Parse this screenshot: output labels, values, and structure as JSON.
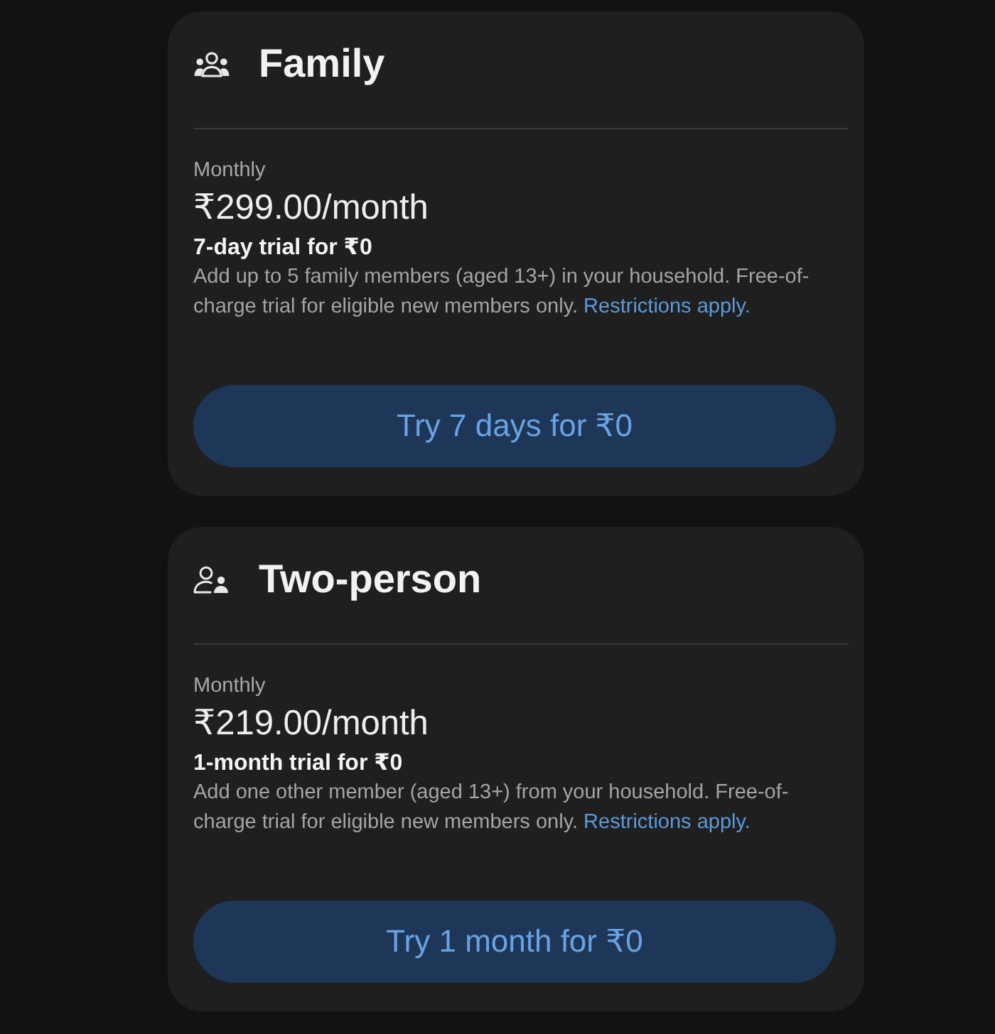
{
  "plans": [
    {
      "kind": "family",
      "title": "Family",
      "billing": "Monthly",
      "price": "₹299.00/month",
      "trial": "7-day trial for ₹0",
      "description": "Add up to 5 family members (aged 13+) in your household. Free-of-charge trial for eligible new members only.",
      "link": "Restrictions apply.",
      "button": "Try 7 days for ₹0"
    },
    {
      "kind": "two_person",
      "title": "Two-person",
      "billing": "Monthly",
      "price": "₹219.00/month",
      "trial": "1-month trial for ₹0",
      "description": "Add one other member (aged 13+) from your household. Free-of-charge trial for eligible new members only.",
      "link": "Restrictions apply.",
      "button": "Try 1 month for ₹0"
    }
  ]
}
